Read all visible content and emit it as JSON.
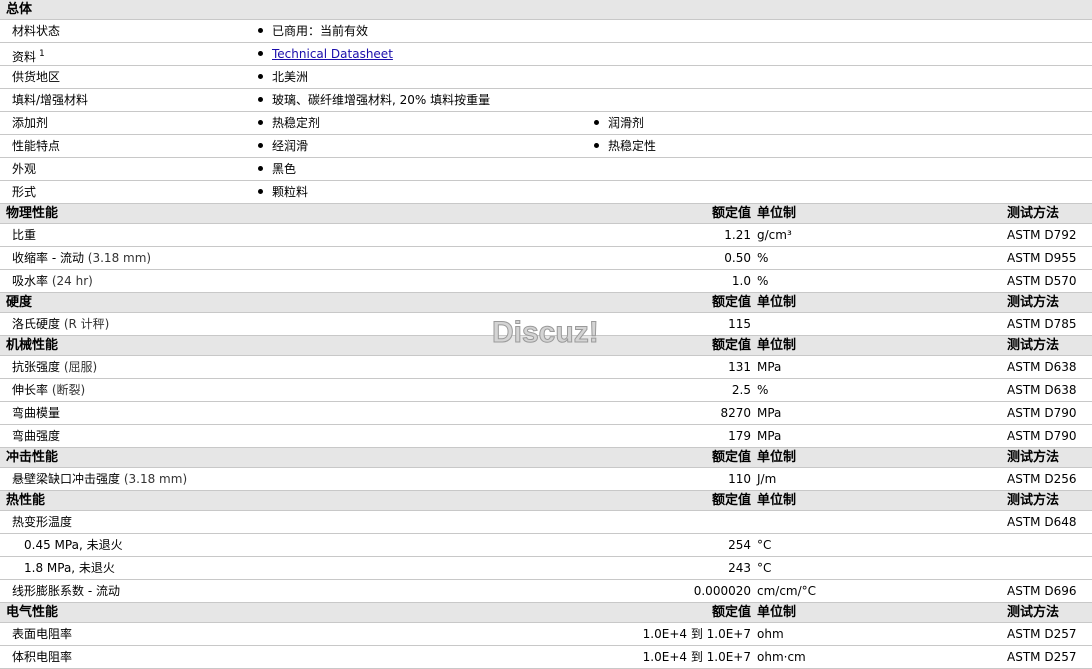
{
  "watermark": "Discuz!",
  "headers": {
    "value": "额定值",
    "unit": "单位制",
    "method": "测试方法"
  },
  "general": {
    "title": "总体",
    "rows": [
      {
        "label": "材料状态",
        "items": [
          "已商用：当前有效"
        ]
      },
      {
        "label": "资料",
        "sup": "1",
        "items": [
          "Technical Datasheet"
        ],
        "link": true
      },
      {
        "label": "供货地区",
        "items": [
          "北美洲"
        ]
      },
      {
        "label": "填料/增强材料",
        "items": [
          "玻璃、碳纤维增强材料, 20% 填料按重量"
        ]
      },
      {
        "label": "添加剂",
        "items": [
          "热稳定剂",
          "润滑剂"
        ]
      },
      {
        "label": "性能特点",
        "items": [
          "经润滑",
          "热稳定性"
        ]
      },
      {
        "label": "外观",
        "items": [
          "黑色"
        ]
      },
      {
        "label": "形式",
        "items": [
          "颗粒料"
        ]
      }
    ]
  },
  "sections": [
    {
      "title": "物理性能",
      "rows": [
        {
          "label": "比重",
          "value": "1.21",
          "unit": "g/cm³",
          "method": "ASTM D792"
        },
        {
          "label": "收缩率 - 流动",
          "cond": "(3.18 mm)",
          "value": "0.50",
          "unit": "%",
          "method": "ASTM D955"
        },
        {
          "label": "吸水率",
          "cond": "(24 hr)",
          "value": "1.0",
          "unit": "%",
          "method": "ASTM D570"
        }
      ]
    },
    {
      "title": "硬度",
      "rows": [
        {
          "label": "洛氏硬度",
          "cond": "(R 计秤)",
          "value": "115",
          "unit": "",
          "method": "ASTM D785"
        }
      ]
    },
    {
      "title": "机械性能",
      "rows": [
        {
          "label": "抗张强度",
          "cond": "(屈服)",
          "value": "131",
          "unit": "MPa",
          "method": "ASTM D638"
        },
        {
          "label": "伸长率",
          "cond": "(断裂)",
          "value": "2.5",
          "unit": "%",
          "method": "ASTM D638"
        },
        {
          "label": "弯曲模量",
          "value": "8270",
          "unit": "MPa",
          "method": "ASTM D790"
        },
        {
          "label": "弯曲强度",
          "value": "179",
          "unit": "MPa",
          "method": "ASTM D790"
        }
      ]
    },
    {
      "title": "冲击性能",
      "rows": [
        {
          "label": "悬壁梁缺口冲击强度",
          "cond": "(3.18 mm)",
          "value": "110",
          "unit": "J/m",
          "method": "ASTM D256"
        }
      ]
    },
    {
      "title": "热性能",
      "rows": [
        {
          "label": "热变形温度",
          "value": "",
          "unit": "",
          "method": "ASTM D648"
        },
        {
          "label": "0.45 MPa, 未退火",
          "indent": true,
          "value": "254",
          "unit": "°C",
          "method": ""
        },
        {
          "label": "1.8 MPa, 未退火",
          "indent": true,
          "value": "243",
          "unit": "°C",
          "method": ""
        },
        {
          "label": "线形膨胀系数 - 流动",
          "value": "0.000020",
          "unit": "cm/cm/°C",
          "method": "ASTM D696"
        }
      ]
    },
    {
      "title": "电气性能",
      "rows": [
        {
          "label": "表面电阻率",
          "value": "1.0E+4 到  1.0E+7",
          "unit": "ohm",
          "method": "ASTM D257"
        },
        {
          "label": "体积电阻率",
          "value": "1.0E+4 到  1.0E+7",
          "unit": "ohm·cm",
          "method": "ASTM D257"
        }
      ]
    }
  ]
}
